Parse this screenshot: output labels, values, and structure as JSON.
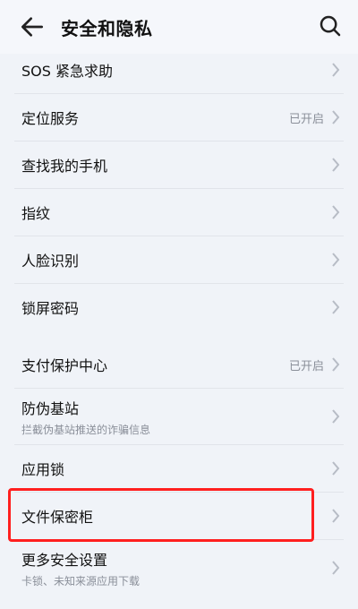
{
  "header": {
    "title": "安全和隐私"
  },
  "items": [
    {
      "label": "SOS 紧急求助",
      "sublabel": "",
      "status": ""
    },
    {
      "label": "定位服务",
      "sublabel": "",
      "status": "已开启"
    },
    {
      "label": "查找我的手机",
      "sublabel": "",
      "status": ""
    },
    {
      "label": "指纹",
      "sublabel": "",
      "status": ""
    },
    {
      "label": "人脸识别",
      "sublabel": "",
      "status": ""
    },
    {
      "label": "锁屏密码",
      "sublabel": "",
      "status": ""
    },
    {
      "label": "支付保护中心",
      "sublabel": "",
      "status": "已开启"
    },
    {
      "label": "防伪基站",
      "sublabel": "拦截伪基站推送的诈骗信息",
      "status": ""
    },
    {
      "label": "应用锁",
      "sublabel": "",
      "status": ""
    },
    {
      "label": "文件保密柜",
      "sublabel": "",
      "status": ""
    },
    {
      "label": "更多安全设置",
      "sublabel": "卡锁、未知来源应用下载",
      "status": ""
    }
  ],
  "highlight_color": "#ff1f1f"
}
